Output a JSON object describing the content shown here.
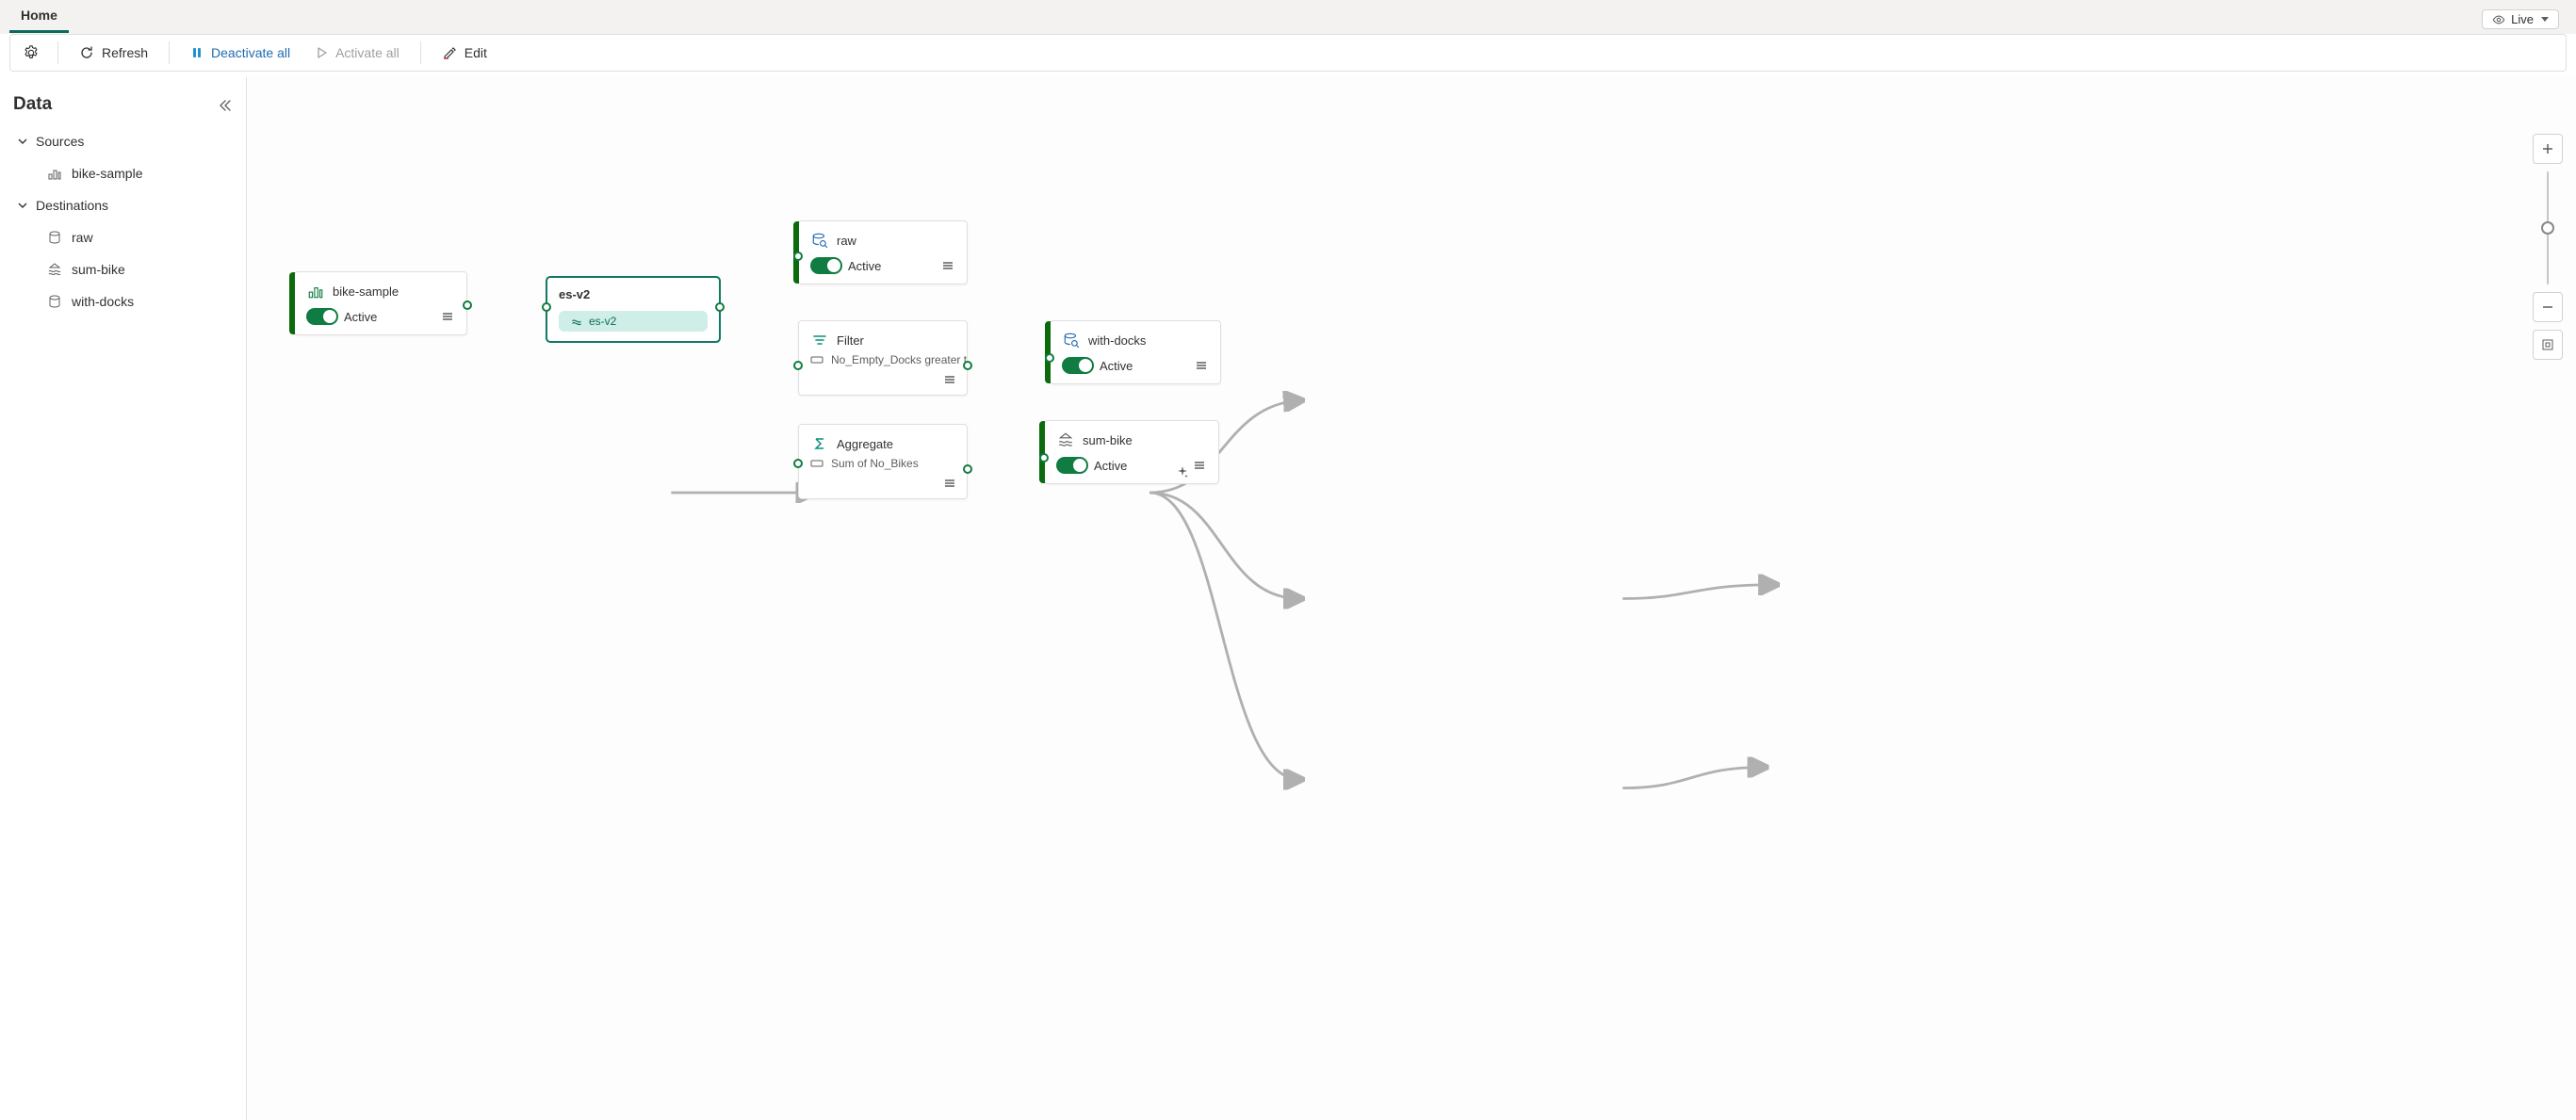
{
  "tabs": {
    "home": "Home"
  },
  "live": {
    "label": "Live"
  },
  "toolbar": {
    "refresh": "Refresh",
    "deactivate_all": "Deactivate all",
    "activate_all": "Activate all",
    "edit": "Edit"
  },
  "sidebar": {
    "title": "Data",
    "sources": {
      "label": "Sources",
      "items": [
        {
          "label": "bike-sample"
        }
      ]
    },
    "destinations": {
      "label": "Destinations",
      "items": [
        {
          "label": "raw"
        },
        {
          "label": "sum-bike"
        },
        {
          "label": "with-docks"
        }
      ]
    }
  },
  "nodes": {
    "bike_sample": {
      "title": "bike-sample",
      "status": "Active"
    },
    "es_v2": {
      "title": "es-v2",
      "chip": "es-v2"
    },
    "raw": {
      "title": "raw",
      "status": "Active"
    },
    "filter": {
      "title": "Filter",
      "detail": "No_Empty_Docks greater t..."
    },
    "aggregate": {
      "title": "Aggregate",
      "detail": "Sum of No_Bikes"
    },
    "with_docks": {
      "title": "with-docks",
      "status": "Active"
    },
    "sum_bike": {
      "title": "sum-bike",
      "status": "Active"
    }
  }
}
